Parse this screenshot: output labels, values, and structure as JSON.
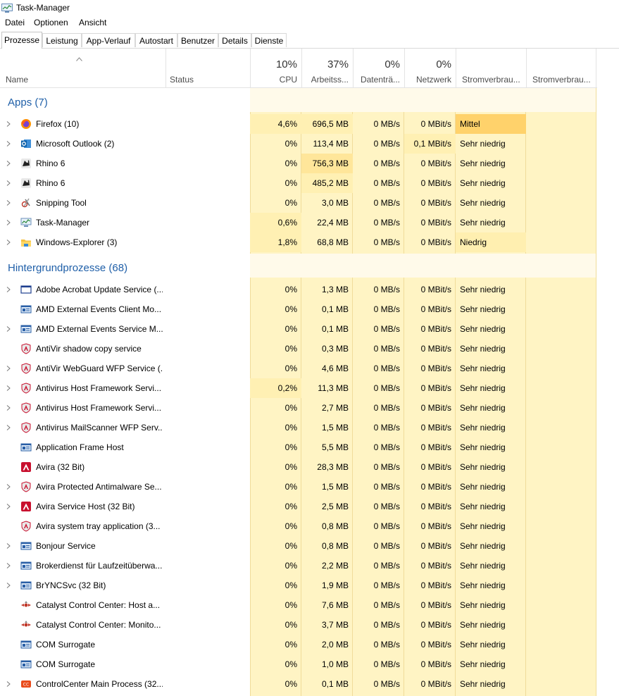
{
  "window": {
    "title": "Task-Manager"
  },
  "menu": [
    "Datei",
    "Optionen",
    "Ansicht"
  ],
  "tabs": [
    "Prozesse",
    "Leistung",
    "App-Verlauf",
    "Autostart",
    "Benutzer",
    "Details",
    "Dienste"
  ],
  "columns": {
    "name": "Name",
    "status": "Status",
    "cpu": {
      "pct": "10%",
      "label": "CPU"
    },
    "mem": {
      "pct": "37%",
      "label": "Arbeitss..."
    },
    "disk": {
      "pct": "0%",
      "label": "Datenträ..."
    },
    "net": {
      "pct": "0%",
      "label": "Netzwerk"
    },
    "power": {
      "label": "Stromverbrau..."
    },
    "power_trend": {
      "label": "Stromverbrau..."
    }
  },
  "groups": {
    "apps": {
      "title": "Apps (7)",
      "rows": [
        {
          "name": "Firefox (10)",
          "icon": "firefox-icon",
          "expand": true,
          "cpu": "4,6%",
          "mem": "696,5 MB",
          "disk": "0 MB/s",
          "net": "0 MBit/s",
          "power": "Mittel",
          "cpu_hl": 1,
          "mem_hl": 1,
          "net_hl": 0,
          "pow_hl": 2
        },
        {
          "name": "Microsoft Outlook (2)",
          "icon": "outlook-icon",
          "expand": true,
          "cpu": "0%",
          "mem": "113,4 MB",
          "disk": "0 MB/s",
          "net": "0,1 MBit/s",
          "power": "Sehr niedrig",
          "cpu_hl": 0,
          "mem_hl": 0,
          "net_hl": 1,
          "pow_hl": 0
        },
        {
          "name": "Rhino 6",
          "icon": "rhino-icon",
          "expand": true,
          "cpu": "0%",
          "mem": "756,3 MB",
          "disk": "0 MB/s",
          "net": "0 MBit/s",
          "power": "Sehr niedrig",
          "cpu_hl": 0,
          "mem_hl": 2,
          "net_hl": 0,
          "pow_hl": 0
        },
        {
          "name": "Rhino 6",
          "icon": "rhino-icon",
          "expand": true,
          "cpu": "0%",
          "mem": "485,2 MB",
          "disk": "0 MB/s",
          "net": "0 MBit/s",
          "power": "Sehr niedrig",
          "cpu_hl": 0,
          "mem_hl": 1,
          "net_hl": 0,
          "pow_hl": 0
        },
        {
          "name": "Snipping Tool",
          "icon": "snipping-tool-icon",
          "expand": true,
          "cpu": "0%",
          "mem": "3,0 MB",
          "disk": "0 MB/s",
          "net": "0 MBit/s",
          "power": "Sehr niedrig",
          "cpu_hl": 0,
          "mem_hl": 0,
          "net_hl": 0,
          "pow_hl": 0
        },
        {
          "name": "Task-Manager",
          "icon": "task-manager-icon",
          "expand": true,
          "cpu": "0,6%",
          "mem": "22,4 MB",
          "disk": "0 MB/s",
          "net": "0 MBit/s",
          "power": "Sehr niedrig",
          "cpu_hl": 1,
          "mem_hl": 0,
          "net_hl": 0,
          "pow_hl": 0
        },
        {
          "name": "Windows-Explorer (3)",
          "icon": "folder-icon",
          "expand": true,
          "cpu": "1,8%",
          "mem": "68,8 MB",
          "disk": "0 MB/s",
          "net": "0 MBit/s",
          "power": "Niedrig",
          "cpu_hl": 1,
          "mem_hl": 0,
          "net_hl": 0,
          "pow_hl": 1
        }
      ]
    },
    "background": {
      "title": "Hintergrundprozesse (68)",
      "rows": [
        {
          "name": "Adobe Acrobat Update Service (...",
          "icon": "window-icon",
          "expand": true,
          "cpu": "0%",
          "mem": "1,3 MB",
          "disk": "0 MB/s",
          "net": "0 MBit/s",
          "power": "Sehr niedrig",
          "cpu_hl": 0,
          "mem_hl": 0,
          "net_hl": 0,
          "pow_hl": 0
        },
        {
          "name": "AMD External Events Client Mo...",
          "icon": "service-icon",
          "expand": false,
          "cpu": "0%",
          "mem": "0,1 MB",
          "disk": "0 MB/s",
          "net": "0 MBit/s",
          "power": "Sehr niedrig",
          "cpu_hl": 0,
          "mem_hl": 0,
          "net_hl": 0,
          "pow_hl": 0
        },
        {
          "name": "AMD External Events Service M...",
          "icon": "service-icon",
          "expand": true,
          "cpu": "0%",
          "mem": "0,1 MB",
          "disk": "0 MB/s",
          "net": "0 MBit/s",
          "power": "Sehr niedrig",
          "cpu_hl": 0,
          "mem_hl": 0,
          "net_hl": 0,
          "pow_hl": 0
        },
        {
          "name": "AntiVir shadow copy service",
          "icon": "shield-icon",
          "expand": false,
          "cpu": "0%",
          "mem": "0,3 MB",
          "disk": "0 MB/s",
          "net": "0 MBit/s",
          "power": "Sehr niedrig",
          "cpu_hl": 0,
          "mem_hl": 0,
          "net_hl": 0,
          "pow_hl": 0
        },
        {
          "name": "AntiVir WebGuard WFP Service (...",
          "icon": "shield-icon",
          "expand": true,
          "cpu": "0%",
          "mem": "4,6 MB",
          "disk": "0 MB/s",
          "net": "0 MBit/s",
          "power": "Sehr niedrig",
          "cpu_hl": 0,
          "mem_hl": 0,
          "net_hl": 0,
          "pow_hl": 0
        },
        {
          "name": "Antivirus Host Framework Servi...",
          "icon": "shield-icon",
          "expand": true,
          "cpu": "0,2%",
          "mem": "11,3 MB",
          "disk": "0 MB/s",
          "net": "0 MBit/s",
          "power": "Sehr niedrig",
          "cpu_hl": 1,
          "mem_hl": 0,
          "net_hl": 0,
          "pow_hl": 0
        },
        {
          "name": "Antivirus Host Framework Servi...",
          "icon": "shield-icon",
          "expand": true,
          "cpu": "0%",
          "mem": "2,7 MB",
          "disk": "0 MB/s",
          "net": "0 MBit/s",
          "power": "Sehr niedrig",
          "cpu_hl": 0,
          "mem_hl": 0,
          "net_hl": 0,
          "pow_hl": 0
        },
        {
          "name": "Antivirus MailScanner WFP Serv...",
          "icon": "shield-icon",
          "expand": true,
          "cpu": "0%",
          "mem": "1,5 MB",
          "disk": "0 MB/s",
          "net": "0 MBit/s",
          "power": "Sehr niedrig",
          "cpu_hl": 0,
          "mem_hl": 0,
          "net_hl": 0,
          "pow_hl": 0
        },
        {
          "name": "Application Frame Host",
          "icon": "service-icon",
          "expand": false,
          "cpu": "0%",
          "mem": "5,5 MB",
          "disk": "0 MB/s",
          "net": "0 MBit/s",
          "power": "Sehr niedrig",
          "cpu_hl": 0,
          "mem_hl": 0,
          "net_hl": 0,
          "pow_hl": 0
        },
        {
          "name": "Avira (32 Bit)",
          "icon": "avira-icon",
          "expand": false,
          "cpu": "0%",
          "mem": "28,3 MB",
          "disk": "0 MB/s",
          "net": "0 MBit/s",
          "power": "Sehr niedrig",
          "cpu_hl": 0,
          "mem_hl": 0,
          "net_hl": 0,
          "pow_hl": 0
        },
        {
          "name": "Avira Protected Antimalware Se...",
          "icon": "shield-icon",
          "expand": true,
          "cpu": "0%",
          "mem": "1,5 MB",
          "disk": "0 MB/s",
          "net": "0 MBit/s",
          "power": "Sehr niedrig",
          "cpu_hl": 0,
          "mem_hl": 0,
          "net_hl": 0,
          "pow_hl": 0
        },
        {
          "name": "Avira Service Host (32 Bit)",
          "icon": "avira-icon",
          "expand": true,
          "cpu": "0%",
          "mem": "2,5 MB",
          "disk": "0 MB/s",
          "net": "0 MBit/s",
          "power": "Sehr niedrig",
          "cpu_hl": 0,
          "mem_hl": 0,
          "net_hl": 0,
          "pow_hl": 0
        },
        {
          "name": "Avira system tray application (3...",
          "icon": "shield-icon",
          "expand": false,
          "cpu": "0%",
          "mem": "0,8 MB",
          "disk": "0 MB/s",
          "net": "0 MBit/s",
          "power": "Sehr niedrig",
          "cpu_hl": 0,
          "mem_hl": 0,
          "net_hl": 0,
          "pow_hl": 0
        },
        {
          "name": "Bonjour Service",
          "icon": "service-icon",
          "expand": true,
          "cpu": "0%",
          "mem": "0,8 MB",
          "disk": "0 MB/s",
          "net": "0 MBit/s",
          "power": "Sehr niedrig",
          "cpu_hl": 0,
          "mem_hl": 0,
          "net_hl": 0,
          "pow_hl": 0
        },
        {
          "name": "Brokerdienst für Laufzeitüberwa...",
          "icon": "service-icon",
          "expand": true,
          "cpu": "0%",
          "mem": "2,2 MB",
          "disk": "0 MB/s",
          "net": "0 MBit/s",
          "power": "Sehr niedrig",
          "cpu_hl": 0,
          "mem_hl": 0,
          "net_hl": 0,
          "pow_hl": 0
        },
        {
          "name": "BrYNCSvc (32 Bit)",
          "icon": "service-icon",
          "expand": true,
          "cpu": "0%",
          "mem": "1,9 MB",
          "disk": "0 MB/s",
          "net": "0 MBit/s",
          "power": "Sehr niedrig",
          "cpu_hl": 0,
          "mem_hl": 0,
          "net_hl": 0,
          "pow_hl": 0
        },
        {
          "name": "Catalyst Control Center: Host a...",
          "icon": "catalyst-icon",
          "expand": false,
          "cpu": "0%",
          "mem": "7,6 MB",
          "disk": "0 MB/s",
          "net": "0 MBit/s",
          "power": "Sehr niedrig",
          "cpu_hl": 0,
          "mem_hl": 0,
          "net_hl": 0,
          "pow_hl": 0
        },
        {
          "name": "Catalyst Control Center: Monito...",
          "icon": "catalyst-icon",
          "expand": false,
          "cpu": "0%",
          "mem": "3,7 MB",
          "disk": "0 MB/s",
          "net": "0 MBit/s",
          "power": "Sehr niedrig",
          "cpu_hl": 0,
          "mem_hl": 0,
          "net_hl": 0,
          "pow_hl": 0
        },
        {
          "name": "COM Surrogate",
          "icon": "service-icon",
          "expand": false,
          "cpu": "0%",
          "mem": "2,0 MB",
          "disk": "0 MB/s",
          "net": "0 MBit/s",
          "power": "Sehr niedrig",
          "cpu_hl": 0,
          "mem_hl": 0,
          "net_hl": 0,
          "pow_hl": 0
        },
        {
          "name": "COM Surrogate",
          "icon": "service-icon",
          "expand": false,
          "cpu": "0%",
          "mem": "1,0 MB",
          "disk": "0 MB/s",
          "net": "0 MBit/s",
          "power": "Sehr niedrig",
          "cpu_hl": 0,
          "mem_hl": 0,
          "net_hl": 0,
          "pow_hl": 0
        },
        {
          "name": "ControlCenter Main Process (32...",
          "icon": "controlcenter-icon",
          "expand": true,
          "cpu": "0%",
          "mem": "0,1 MB",
          "disk": "0 MB/s",
          "net": "0 MBit/s",
          "power": "Sehr niedrig",
          "cpu_hl": 0,
          "mem_hl": 0,
          "net_hl": 0,
          "pow_hl": 0
        }
      ]
    }
  }
}
